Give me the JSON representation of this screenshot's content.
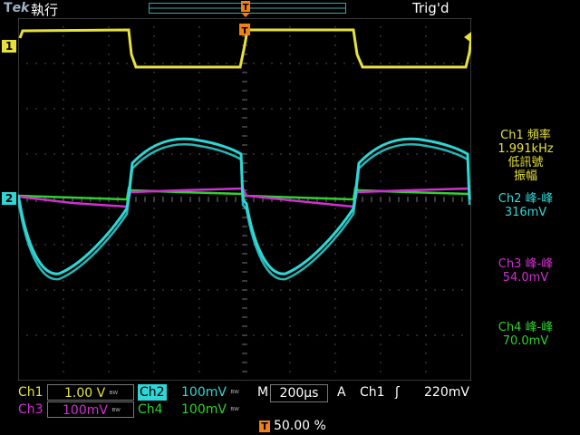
{
  "topbar": {
    "brand_t": "T",
    "brand_ek": "ek",
    "mode": "執行",
    "trig_status": "Trig'd"
  },
  "markers": {
    "ch1": "1",
    "ch2": "2",
    "trigger": "T"
  },
  "measurements": [
    {
      "channel": "Ch1",
      "lines": [
        "Ch1 頻率",
        "1.991kHz",
        "低訊號",
        "振幅"
      ],
      "color": "#e6e13a"
    },
    {
      "channel": "Ch2",
      "lines": [
        "Ch2 峰-峰",
        "316mV"
      ],
      "color": "#2fd6d6"
    },
    {
      "channel": "Ch3",
      "lines": [
        "Ch3 峰-峰",
        "54.0mV"
      ],
      "color": "#d12fd1"
    },
    {
      "channel": "Ch4",
      "lines": [
        "Ch4 峰-峰",
        "70.0mV"
      ],
      "color": "#2fd12f"
    }
  ],
  "status": {
    "ch1_label": "Ch1",
    "ch1_scale": "1.00 V",
    "ch2_label": "Ch2",
    "ch2_scale": "100mV",
    "ch3_label": "Ch3",
    "ch3_scale": "100mV",
    "ch4_label": "Ch4",
    "ch4_scale": "100mV",
    "bw_symbol": "ᴮᵂ",
    "time_label": "M",
    "time_scale": "200µs",
    "trigger_mode": "A",
    "trigger_source": "Ch1",
    "trigger_slope": "ʃ",
    "trigger_level": "220mV",
    "trigger_position": "50.00 %"
  },
  "colors": {
    "ch1": "#e6e13a",
    "ch2": "#2fd6d6",
    "ch3": "#d12fd1",
    "ch4": "#2fd12f",
    "trigger": "#f08018",
    "grid": "#6e6e6e"
  }
}
